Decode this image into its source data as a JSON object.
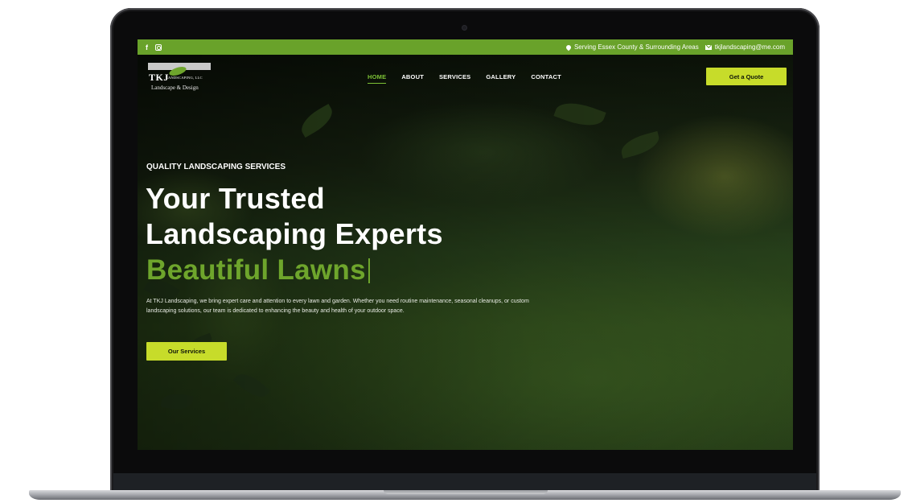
{
  "topbar": {
    "facebook_icon": "f",
    "instagram_icon": "instagram-icon",
    "location": "Serving Essex County & Surrounding Areas",
    "email": "tkjlandscaping@me.com",
    "bar_color": "#69a22a"
  },
  "logo": {
    "brand": "TKJ",
    "brand_suffix": "LANDSCAPING, LLC",
    "tagline": "Landscape & Design"
  },
  "nav": {
    "items": [
      {
        "label": "HOME",
        "active": true
      },
      {
        "label": "ABOUT",
        "active": false
      },
      {
        "label": "SERVICES",
        "active": false
      },
      {
        "label": "GALLERY",
        "active": false
      },
      {
        "label": "CONTACT",
        "active": false
      }
    ],
    "cta_label": "Get a Quote"
  },
  "hero": {
    "eyebrow": "QUALITY LANDSCAPING SERVICES",
    "headline_line1": "Your Trusted",
    "headline_line2": "Landscaping Experts",
    "typed_text": "Beautiful Lawns",
    "description": "At TKJ Landscaping, we bring expert care and attention to every lawn and garden. Whether you need routine maintenance, seasonal cleanups, or custom landscaping solutions, our team is dedicated to enhancing the beauty and health of your outdoor space.",
    "button_label": "Our Services"
  },
  "colors": {
    "accent_green": "#6ea52c",
    "button_yellow": "#c7dc2a"
  }
}
